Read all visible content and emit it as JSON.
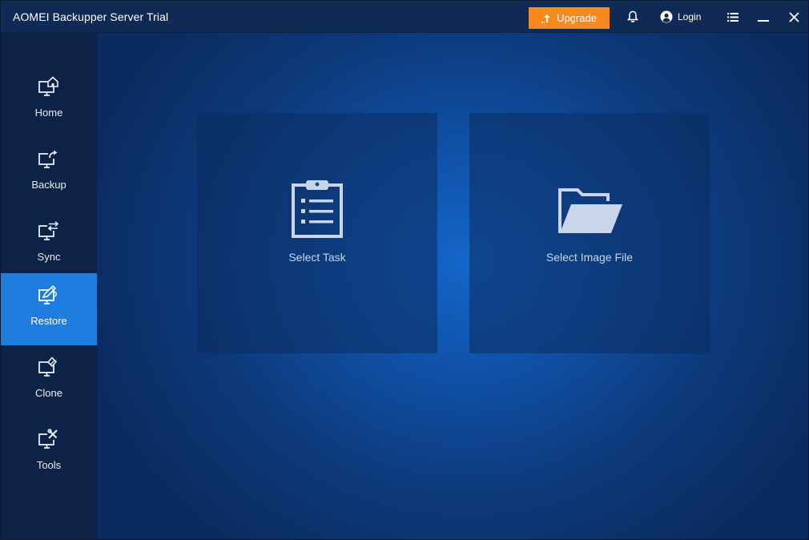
{
  "window": {
    "title": "AOMEI Backupper Server Trial"
  },
  "titlebar": {
    "upgrade_label": "Upgrade",
    "login_label": "Login",
    "icons": [
      "upgrade-arrow-icon",
      "bell-icon",
      "user-icon",
      "menu-icon",
      "minimize-icon",
      "close-icon"
    ]
  },
  "sidebar": {
    "items": [
      {
        "label": "Home",
        "icon": "home-monitor-icon",
        "active": false
      },
      {
        "label": "Backup",
        "icon": "backup-monitor-icon",
        "active": false
      },
      {
        "label": "Sync",
        "icon": "sync-monitor-icon",
        "active": false
      },
      {
        "label": "Restore",
        "icon": "restore-monitor-icon",
        "active": true
      },
      {
        "label": "Clone",
        "icon": "clone-monitor-icon",
        "active": false
      },
      {
        "label": "Tools",
        "icon": "tools-monitor-icon",
        "active": false
      }
    ]
  },
  "main": {
    "cards": [
      {
        "label": "Select Task",
        "icon": "clipboard-list-icon"
      },
      {
        "label": "Select Image File",
        "icon": "folder-open-icon"
      }
    ]
  },
  "colors": {
    "accent": "#1f7de0",
    "upgrade": "#f7891f",
    "titlebar": "#0f2a55",
    "sidebar": "#0d2247",
    "card_text": "#c9d6ea"
  }
}
